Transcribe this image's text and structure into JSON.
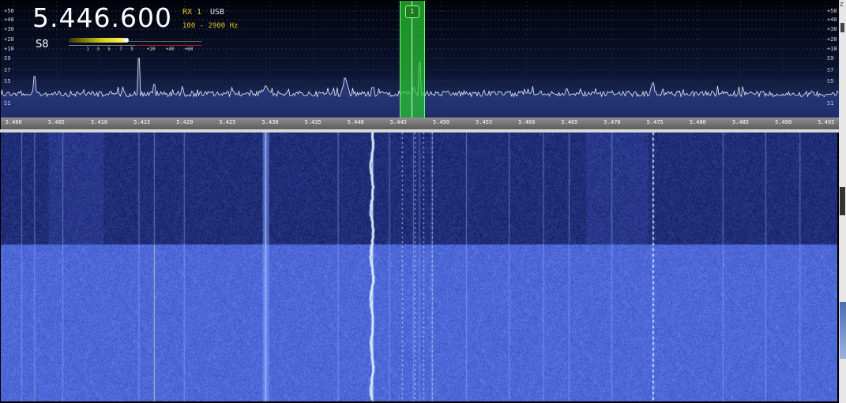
{
  "receiver": {
    "frequency": "5.446.600",
    "rx_label": "RX 1",
    "mode": "USB",
    "bandwidth": "100 - 2900 Hz",
    "s_reading": "S8",
    "s_meter_level": 0.43,
    "s_meter_scale": [
      "1",
      "3",
      "5",
      "7",
      "9",
      "+20",
      "+40",
      "+60"
    ],
    "vfo_marker_label": "1",
    "vfo_center_mhz": 5.4465
  },
  "spectrum": {
    "level_labels_left": [
      "+50",
      "+40",
      "+30",
      "+20",
      "+10",
      "S9",
      "S7",
      "S5",
      "S1"
    ],
    "level_labels_right": [
      "+50",
      "+40",
      "+30",
      "+20",
      "+10",
      "S9",
      "S7",
      "S5",
      "S1"
    ],
    "freq_range_mhz": [
      5.3985,
      5.4965
    ],
    "axis_labels": [
      "5.400",
      "5.405",
      "5.410",
      "5.415",
      "5.420",
      "5.425",
      "5.430",
      "5.435",
      "5.440",
      "5.445",
      "5.450",
      "5.455",
      "5.460",
      "5.465",
      "5.470",
      "5.475",
      "5.480",
      "5.485",
      "5.490",
      "5.495"
    ],
    "axis_values_mhz": [
      5.4,
      5.405,
      5.41,
      5.415,
      5.42,
      5.425,
      5.43,
      5.435,
      5.44,
      5.445,
      5.45,
      5.455,
      5.46,
      5.465,
      5.47,
      5.475,
      5.48,
      5.485,
      5.49,
      5.495
    ],
    "signal_peaks_mhz": [
      5.4025,
      5.4147,
      5.4165,
      5.4295,
      5.4388,
      5.442,
      5.4468,
      5.4475,
      5.4748
    ]
  },
  "waterfall": {
    "carrier_lines_mhz": [
      5.401,
      5.4025,
      5.4058,
      5.4147,
      5.4165,
      5.42,
      5.4295,
      5.438,
      5.442,
      5.444,
      5.4468,
      5.4475,
      5.449,
      5.453,
      5.458,
      5.462,
      5.465,
      5.47,
      5.4748,
      5.483,
      5.488,
      5.492
    ]
  },
  "scrollbar": {
    "top_label": "Z"
  },
  "colors": {
    "waterfall_dark": "#1c2a78",
    "waterfall_light": "#4f6ad6",
    "vfo_green": "#2ec83a",
    "trace": "#e8eef8",
    "readout_yellow": "#e8c51e"
  }
}
